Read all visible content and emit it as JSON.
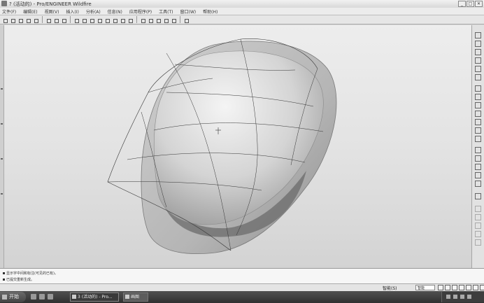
{
  "window": {
    "title": "? (活动的) - Pro/ENGINEER Wildfire",
    "buttons": [
      "_",
      "□",
      "✕"
    ]
  },
  "menubar": {
    "items": [
      "文件(F)",
      "编辑(E)",
      "视图(V)",
      "插入(I)",
      "分析(A)",
      "信息(N)",
      "应用程序(P)",
      "工具(T)",
      "窗口(W)",
      "帮助(H)"
    ]
  },
  "messages": [
    "显示字中间和标注(可见的已有)。",
    "已提交重新生成。"
  ],
  "status": {
    "label": "智能(S)",
    "filter_value": "智能"
  },
  "taskbar": {
    "start_label": "开始",
    "tasks": [
      "3 (活动的) - Pro...",
      "画图"
    ]
  },
  "icons": {
    "toolbar": [
      "new-icon",
      "open-icon",
      "save-icon",
      "print-icon",
      "email-icon",
      "cut-icon",
      "copy-icon",
      "paste-icon",
      "regenerate-icon",
      "repaint-icon",
      "zoom-in-icon",
      "zoom-out-icon",
      "refit-icon",
      "orient-icon",
      "saved-views-icon",
      "layers-icon",
      "datum-planes-icon",
      "datum-axes-icon",
      "datum-points-icon",
      "coord-sys-icon",
      "spin-center-icon",
      "context-help-icon"
    ],
    "right": [
      "datum-plane-icon",
      "datum-axis-icon",
      "datum-curve-icon",
      "datum-point-icon",
      "coord-sys-icon",
      "sketch-icon",
      "extrude-icon",
      "revolve-icon",
      "variable-sweep-icon",
      "blend-icon",
      "style-icon",
      "hole-icon",
      "shell-icon",
      "rib-icon",
      "draft-icon",
      "round-icon",
      "chamfer-icon",
      "pattern-icon",
      "mirror-icon",
      "merge-icon",
      "trim-icon",
      "offset-icon",
      "thicken-icon",
      "solidify-icon"
    ]
  },
  "colors": {
    "viewport_top": "#ededed",
    "viewport_bottom": "#d3d3d3",
    "model_fill": "#bcbcbc",
    "wireframe": "#333333"
  }
}
